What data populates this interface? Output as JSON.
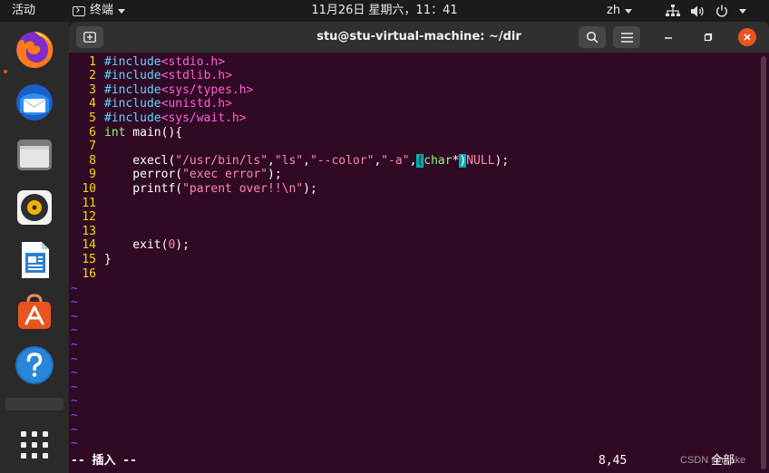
{
  "topbar": {
    "activities": "活动",
    "app_name": "终端",
    "clock": "11月26日 星期六，11：41",
    "input_method": "zh"
  },
  "dock": {
    "items": [
      {
        "name": "firefox"
      },
      {
        "name": "thunderbird"
      },
      {
        "name": "files"
      },
      {
        "name": "rhythmbox"
      },
      {
        "name": "libreoffice-writer"
      },
      {
        "name": "ubuntu-software"
      },
      {
        "name": "help"
      },
      {
        "name": "show-applications"
      }
    ]
  },
  "window": {
    "title": "stu@stu-virtual-machine: ~/dir"
  },
  "editor": {
    "line_numbers": [
      "1",
      "2",
      "3",
      "4",
      "5",
      "6",
      "7",
      "8",
      "9",
      "10",
      "11",
      "12",
      "13",
      "14",
      "15",
      "16"
    ],
    "lines": [
      "#include<stdio.h>",
      "#include<stdlib.h>",
      "#include<sys/types.h>",
      "#include<unistd.h>",
      "#include<sys/wait.h>",
      "int main(){",
      "",
      "    execl(\"/usr/bin/ls\",\"ls\",\"--color\",\"-a\",(char*)NULL);",
      "    perror(\"exec error\");",
      "    printf(\"parent over!!\\n\");",
      "",
      "",
      "",
      "    exit(0);",
      "}",
      ""
    ],
    "tilde": "~",
    "status_mode": "-- 插入 --",
    "cursor_position": "8,45",
    "scroll_position": "全部"
  },
  "colors": {
    "terminal_bg": "#300a24",
    "line_number": "#ffd700",
    "preproc": "#5fd7ff",
    "string": "#ff87af",
    "type": "#87ff87",
    "match_highlight": "#00afaf",
    "tilde": "#6060ff",
    "close_button": "#e95420"
  },
  "watermark": "CSDN @rcake"
}
